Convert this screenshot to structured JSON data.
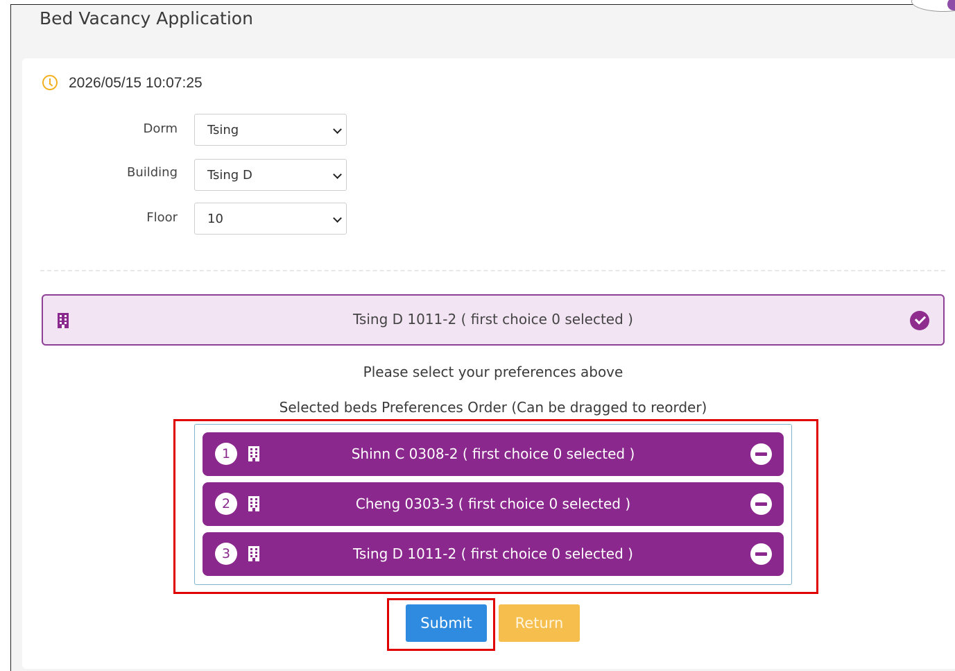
{
  "page": {
    "title": "Bed Vacancy Application",
    "timestamp": "2026/05/15 10:07:25"
  },
  "filters": {
    "dorm": {
      "label": "Dorm",
      "value": "Tsing"
    },
    "building": {
      "label": "Building",
      "value": "Tsing D"
    },
    "floor": {
      "label": "Floor",
      "value": "10"
    }
  },
  "bed_option": {
    "label": "Tsing D 1011-2 ( first choice 0 selected )",
    "icon": "building-icon",
    "selected": true,
    "selected_icon": "check-circle-icon"
  },
  "hints": {
    "select_prompt": "Please select your preferences above",
    "order_title": "Selected beds Preferences Order (Can be dragged to reorder)"
  },
  "preferences": [
    {
      "rank": "1",
      "label": "Shinn C 0308-2 ( first choice 0 selected )"
    },
    {
      "rank": "2",
      "label": "Cheng 0303-3 ( first choice 0 selected )"
    },
    {
      "rank": "3",
      "label": "Tsing D 1011-2 ( first choice 0 selected )"
    }
  ],
  "buttons": {
    "submit": "Submit",
    "return": "Return"
  },
  "colors": {
    "accent_purple": "#8b288e",
    "option_bg": "#f3e4f4",
    "submit_blue": "#2e8be0",
    "return_orange": "#f6bf4d",
    "highlight_red": "#e00000",
    "clock_yellow": "#f2b01e"
  }
}
